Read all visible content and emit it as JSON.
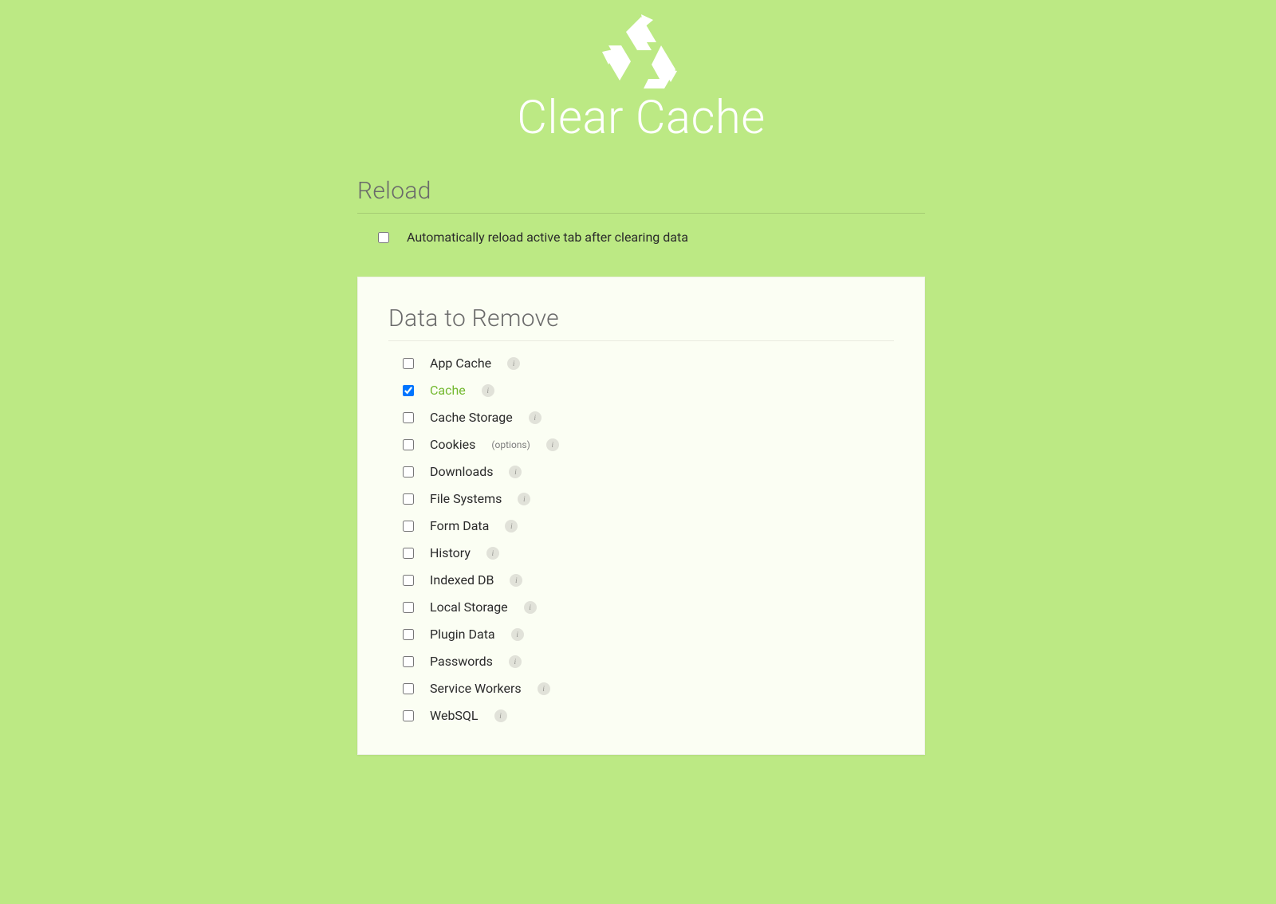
{
  "header": {
    "title": "Clear Cache"
  },
  "reload": {
    "section_title": "Reload",
    "auto_reload_label": "Automatically reload active tab after clearing data",
    "auto_reload_checked": false
  },
  "data_to_remove": {
    "section_title": "Data to Remove",
    "items": [
      {
        "label": "App Cache",
        "checked": false,
        "has_options": false
      },
      {
        "label": "Cache",
        "checked": true,
        "has_options": false
      },
      {
        "label": "Cache Storage",
        "checked": false,
        "has_options": false
      },
      {
        "label": "Cookies",
        "checked": false,
        "has_options": true
      },
      {
        "label": "Downloads",
        "checked": false,
        "has_options": false
      },
      {
        "label": "File Systems",
        "checked": false,
        "has_options": false
      },
      {
        "label": "Form Data",
        "checked": false,
        "has_options": false
      },
      {
        "label": "History",
        "checked": false,
        "has_options": false
      },
      {
        "label": "Indexed DB",
        "checked": false,
        "has_options": false
      },
      {
        "label": "Local Storage",
        "checked": false,
        "has_options": false
      },
      {
        "label": "Plugin Data",
        "checked": false,
        "has_options": false
      },
      {
        "label": "Passwords",
        "checked": false,
        "has_options": false
      },
      {
        "label": "Service Workers",
        "checked": false,
        "has_options": false
      },
      {
        "label": "WebSQL",
        "checked": false,
        "has_options": false
      }
    ],
    "options_link_text": "(options)",
    "info_char": "i"
  }
}
